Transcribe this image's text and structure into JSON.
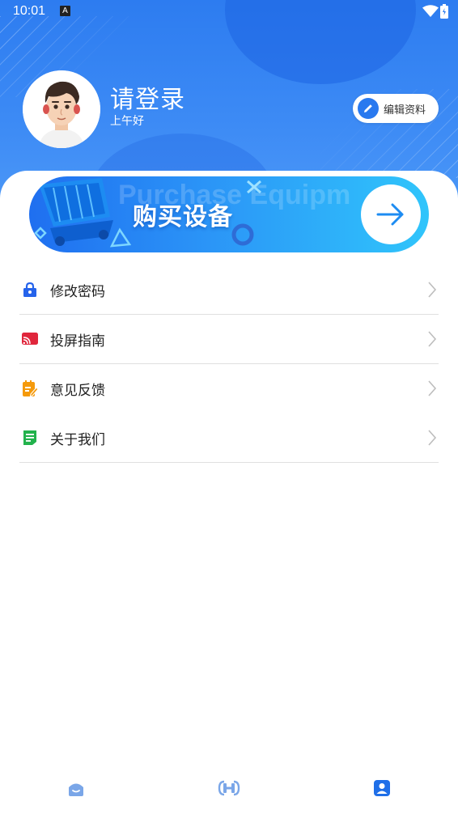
{
  "status_bar": {
    "time": "10:01",
    "notification_icon_letter": "A",
    "wifi_icon": "wifi-icon",
    "battery_icon": "battery-icon"
  },
  "profile": {
    "username": "请登录",
    "greeting": "上午好",
    "edit_label": "编辑资料",
    "edit_icon": "pencil-icon"
  },
  "banner": {
    "title": "购买设备",
    "bg_text": "Purchase Equipm",
    "arrow_icon": "arrow-right-icon"
  },
  "menu": {
    "items": [
      {
        "label": "修改密码",
        "icon": "lock-icon",
        "color": "#2563eb"
      },
      {
        "label": "投屏指南",
        "icon": "cast-icon",
        "color": "#e0263c"
      },
      {
        "label": "意见反馈",
        "icon": "feedback-icon",
        "color": "#f59a0b"
      },
      {
        "label": "关于我们",
        "icon": "document-icon",
        "color": "#22b24c"
      }
    ]
  },
  "bottom_nav": {
    "items": [
      {
        "name": "home",
        "icon": "home-icon",
        "active": false
      },
      {
        "name": "device",
        "icon": "device-icon",
        "active": false
      },
      {
        "name": "profile",
        "icon": "user-icon",
        "active": true
      }
    ]
  },
  "colors": {
    "header_blue": "#2d7cf0",
    "accent": "#2979ef",
    "nav_inactive": "#7aa6e8",
    "nav_active": "#1f6fe8"
  }
}
